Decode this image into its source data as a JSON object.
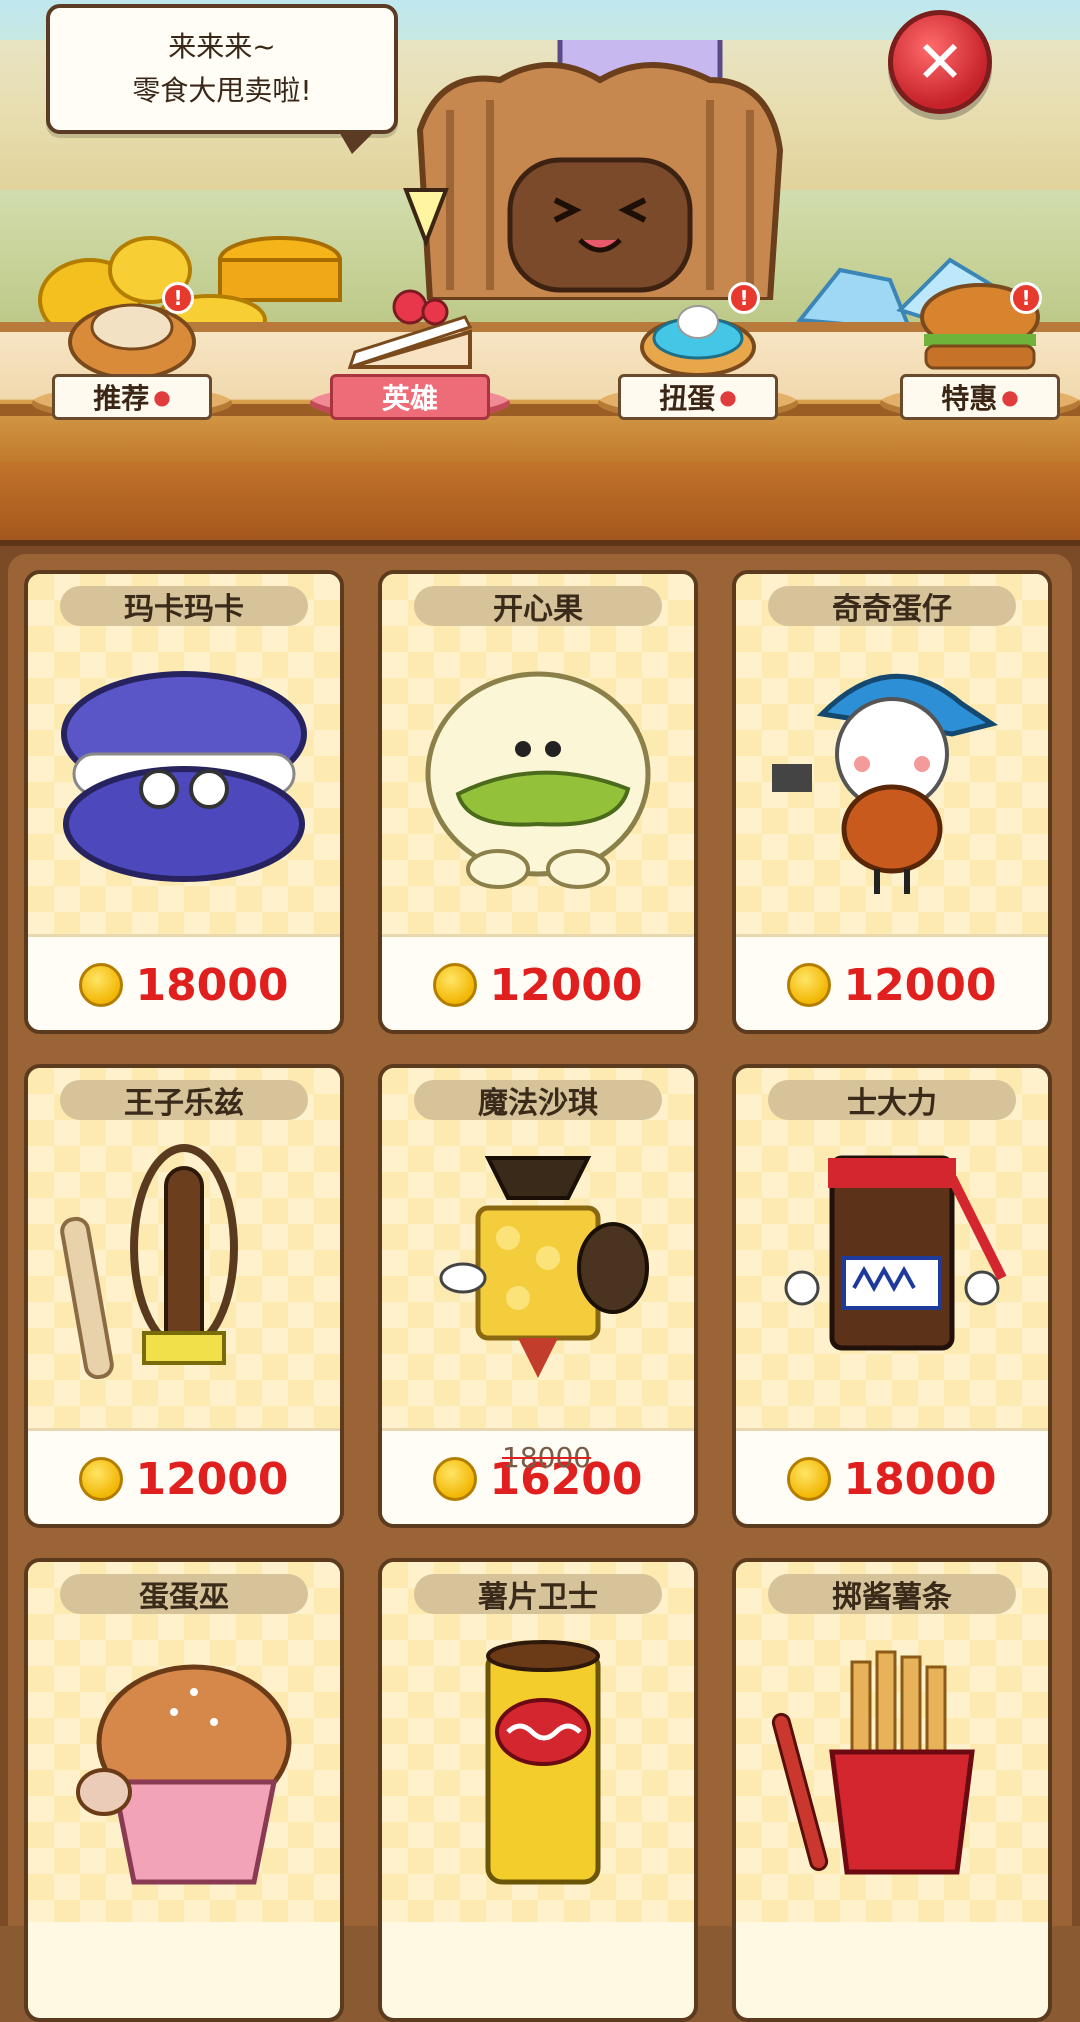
{
  "bubble": {
    "line1": "来来来~",
    "line2": "零食大甩卖啦!"
  },
  "close_label": "✕",
  "tabs": [
    {
      "label": "推荐",
      "icon": "strawberry-icon",
      "badge": "!",
      "active": false
    },
    {
      "label": "英雄",
      "icon": "",
      "badge": "",
      "active": true
    },
    {
      "label": "扭蛋",
      "icon": "strawberry-icon",
      "badge": "!",
      "active": false
    },
    {
      "label": "特惠",
      "icon": "strawberry-icon",
      "badge": "!",
      "active": false
    }
  ],
  "heroes": [
    {
      "name": "玛卡玛卡",
      "price": "18000",
      "old_price": "",
      "char": "macaron"
    },
    {
      "name": "开心果",
      "price": "12000",
      "old_price": "",
      "char": "pistachio"
    },
    {
      "name": "奇奇蛋仔",
      "price": "12000",
      "old_price": "",
      "char": "egg-cap"
    },
    {
      "name": "王子乐兹",
      "price": "12000",
      "old_price": "",
      "char": "pretzel-stick"
    },
    {
      "name": "魔法沙琪",
      "price": "16200",
      "old_price": "18000",
      "char": "sachima"
    },
    {
      "name": "士大力",
      "price": "18000",
      "old_price": "",
      "char": "chocolate-bar"
    },
    {
      "name": "蛋蛋巫",
      "price": "",
      "old_price": "",
      "char": "cupcake"
    },
    {
      "name": "薯片卫士",
      "price": "",
      "old_price": "",
      "char": "chips-can"
    },
    {
      "name": "掷酱薯条",
      "price": "",
      "old_price": "",
      "char": "fries"
    }
  ],
  "colors": {
    "price": "#e0201f",
    "active_tab": "#ee6b78",
    "close": "#c6222a",
    "coin": "#f2b705"
  }
}
